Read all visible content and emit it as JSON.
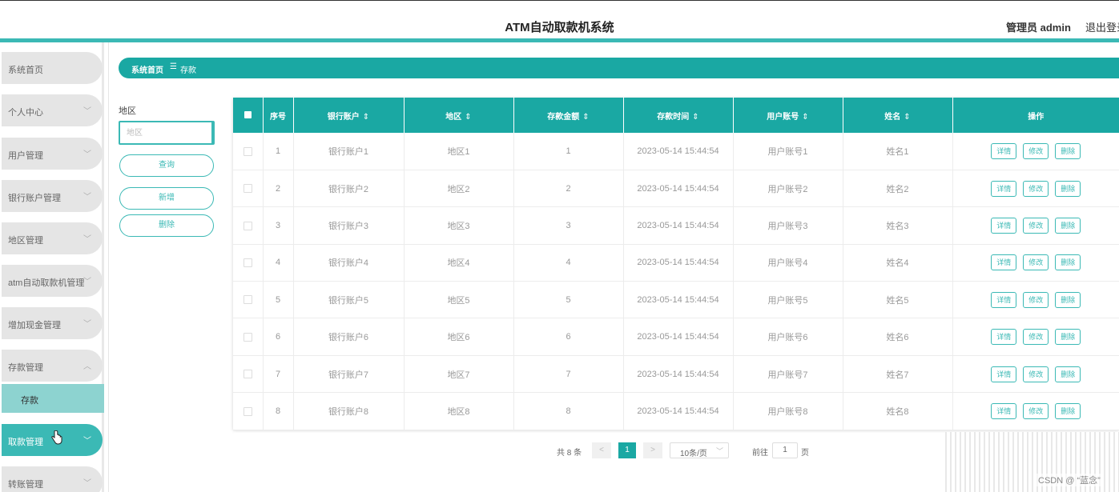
{
  "header": {
    "title": "ATM自动取款机系统",
    "admin": "管理员 admin",
    "logout": "退出登录"
  },
  "sidebar": {
    "items": [
      {
        "label": "系统首页",
        "chevron": ""
      },
      {
        "label": "个人中心",
        "chevron": "﹀"
      },
      {
        "label": "用户管理",
        "chevron": "﹀"
      },
      {
        "label": "银行账户管理",
        "chevron": "﹀"
      },
      {
        "label": "地区管理",
        "chevron": "﹀"
      },
      {
        "label": "atm自动取款机管理",
        "chevron": "﹀"
      },
      {
        "label": "增加现金管理",
        "chevron": "﹀"
      },
      {
        "label": "存款管理",
        "chevron": "︿"
      },
      {
        "label": "取款管理",
        "chevron": "﹀"
      },
      {
        "label": "转账管理",
        "chevron": "﹀"
      }
    ],
    "subitem": "存款"
  },
  "breadcrumb": {
    "home": "系统首页",
    "separator": "☰",
    "current": "存款"
  },
  "search": {
    "label": "地区",
    "placeholder": "地区",
    "query_button": "查询",
    "add_button": "新增",
    "delete_button": "删除"
  },
  "table": {
    "columns": [
      "序号",
      "银行账户",
      "地区",
      "存款金额",
      "存款时间",
      "用户账号",
      "姓名",
      "操作"
    ],
    "sort_icon": "⇕",
    "rows": [
      {
        "no": "1",
        "account": "银行账户1",
        "region": "地区1",
        "amount": "1",
        "time": "2023-05-14 15:44:54",
        "user": "用户账号1",
        "name": "姓名1"
      },
      {
        "no": "2",
        "account": "银行账户2",
        "region": "地区2",
        "amount": "2",
        "time": "2023-05-14 15:44:54",
        "user": "用户账号2",
        "name": "姓名2"
      },
      {
        "no": "3",
        "account": "银行账户3",
        "region": "地区3",
        "amount": "3",
        "time": "2023-05-14 15:44:54",
        "user": "用户账号3",
        "name": "姓名3"
      },
      {
        "no": "4",
        "account": "银行账户4",
        "region": "地区4",
        "amount": "4",
        "time": "2023-05-14 15:44:54",
        "user": "用户账号4",
        "name": "姓名4"
      },
      {
        "no": "5",
        "account": "银行账户5",
        "region": "地区5",
        "amount": "5",
        "time": "2023-05-14 15:44:54",
        "user": "用户账号5",
        "name": "姓名5"
      },
      {
        "no": "6",
        "account": "银行账户6",
        "region": "地区6",
        "amount": "6",
        "time": "2023-05-14 15:44:54",
        "user": "用户账号6",
        "name": "姓名6"
      },
      {
        "no": "7",
        "account": "银行账户7",
        "region": "地区7",
        "amount": "7",
        "time": "2023-05-14 15:44:54",
        "user": "用户账号7",
        "name": "姓名7"
      },
      {
        "no": "8",
        "account": "银行账户8",
        "region": "地区8",
        "amount": "8",
        "time": "2023-05-14 15:44:54",
        "user": "用户账号8",
        "name": "姓名8"
      }
    ],
    "actions": {
      "detail": "详情",
      "edit": "修改",
      "delete": "删除"
    }
  },
  "pagination": {
    "total": "共 8 条",
    "prev": "<",
    "current_page": "1",
    "next": ">",
    "page_size": "10条/页",
    "goto": "前往",
    "jump_value": "1",
    "page_suffix": "页"
  },
  "watermark": "CSDN @ “蓝念”",
  "colors": {
    "accent": "#3bb9b5",
    "accent_dark": "#1aa8a3",
    "sub_active": "#8dd3d0"
  }
}
